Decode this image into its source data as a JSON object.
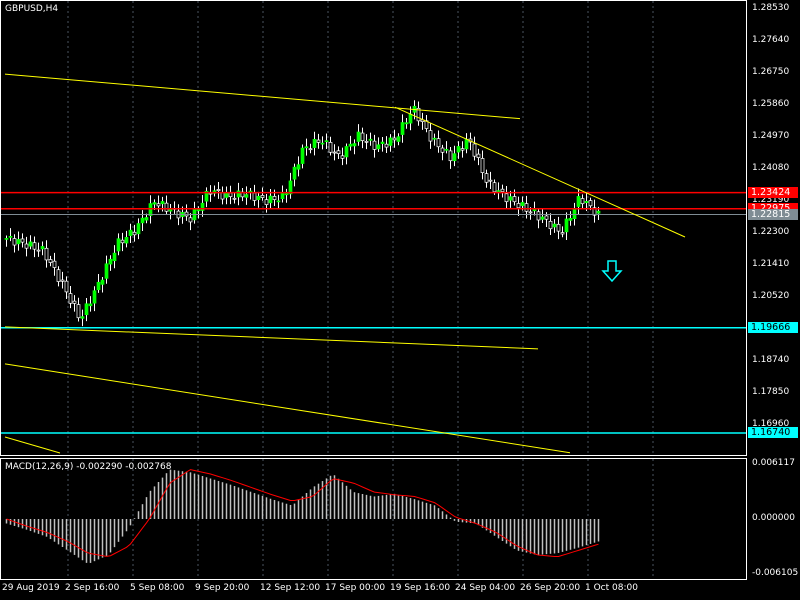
{
  "chart_title": "GBPUSD,H4",
  "macd_title": "MACD(12,26,9) -0.002290 -0.002768",
  "price_axis": [
    "1.28530",
    "1.27640",
    "1.26750",
    "1.25860",
    "1.24970",
    "1.24080",
    "1.23190",
    "1.22300",
    "1.21410",
    "1.20520",
    "1.18740",
    "1.17850",
    "1.16960"
  ],
  "macd_axis": [
    "0.006117",
    "0.000000",
    "-0.006105"
  ],
  "price_tags": [
    {
      "text": "1.23424",
      "bg": "#ff0000",
      "fg": "#ffffff",
      "price": 1.23424
    },
    {
      "text": "1.22975",
      "bg": "#ff0000",
      "fg": "#ffffff",
      "price": 1.22975
    },
    {
      "text": "1.22815",
      "bg": "#7f8c94",
      "fg": "#ffffff",
      "price": 1.22815
    },
    {
      "text": "1.19666",
      "bg": "#00ffff",
      "fg": "#000000",
      "price": 1.19666
    },
    {
      "text": "1.16740",
      "bg": "#00ffff",
      "fg": "#000000",
      "price": 1.1674
    }
  ],
  "time_axis": [
    "29 Aug 2019",
    "2 Sep 16:00",
    "5 Sep 08:00",
    "9 Sep 20:00",
    "12 Sep 12:00",
    "17 Sep 00:00",
    "19 Sep 16:00",
    "24 Sep 04:00",
    "26 Sep 20:00",
    "1 Oct 08:00"
  ],
  "chart_data": {
    "type": "candlestick",
    "symbol": "GBPUSD",
    "timeframe": "H4",
    "ylim": [
      1.1653,
      1.2875
    ],
    "close_keypoints": [
      1.2215,
      1.22,
      1.218,
      1.209,
      1.199,
      1.209,
      1.22,
      1.224,
      1.2318,
      1.229,
      1.227,
      1.235,
      1.233,
      1.234,
      1.232,
      1.233,
      1.246,
      1.249,
      1.244,
      1.25,
      1.247,
      1.249,
      1.2577,
      1.249,
      1.244,
      1.249,
      1.237,
      1.233,
      1.23,
      1.227,
      1.223,
      1.233,
      1.228
    ],
    "macd_hist_keypoints": [
      -0.0005,
      -0.0012,
      -0.002,
      -0.0035,
      -0.005,
      -0.004,
      -0.001,
      0.003,
      0.0055,
      0.0052,
      0.0045,
      0.0038,
      0.003,
      0.0022,
      0.0015,
      0.0035,
      0.005,
      0.003,
      0.0025,
      0.0028,
      0.0022,
      0.0015,
      -0.0003,
      -0.0005,
      -0.002,
      -0.0035,
      -0.004,
      -0.0038,
      -0.0032,
      -0.0025
    ],
    "macd_signal_keypoints": [
      0.0,
      -0.0008,
      -0.0015,
      -0.0025,
      -0.0038,
      -0.0042,
      -0.003,
      0.0,
      0.004,
      0.0055,
      0.005,
      0.0043,
      0.0035,
      0.0027,
      0.002,
      0.0025,
      0.0045,
      0.004,
      0.003,
      0.0027,
      0.0025,
      0.0018,
      0.0002,
      -0.0005,
      -0.0015,
      -0.003,
      -0.004,
      -0.0042,
      -0.0035,
      -0.0028
    ],
    "macd_ylim": [
      -0.006105,
      0.006117
    ],
    "horizontal_lines": [
      {
        "price": 1.23424,
        "color": "#ff0000"
      },
      {
        "price": 1.22975,
        "color": "#ff0000"
      },
      {
        "price": 1.19666,
        "color": "#00ffff"
      },
      {
        "price": 1.1674,
        "color": "#00ffff"
      }
    ],
    "trendlines": [
      [
        1.2672,
        1.2548
      ],
      [
        1.258,
        1.2219
      ],
      [
        1.1969,
        1.1908
      ],
      [
        1.1866,
        1.1619
      ]
    ]
  }
}
